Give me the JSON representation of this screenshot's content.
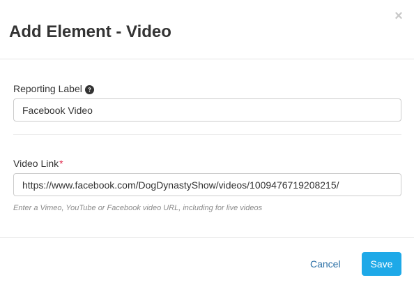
{
  "modal": {
    "title": "Add Element - Video",
    "close_glyph": "×"
  },
  "fields": {
    "reporting_label": {
      "label": "Reporting Label",
      "help_icon": "question-circle-icon",
      "value": "Facebook Video"
    },
    "video_link": {
      "label": "Video Link",
      "required_marker": "*",
      "value": "https://www.facebook.com/DogDynastyShow/videos/1009476719208215/",
      "help_text": "Enter a Vimeo, YouTube or Facebook video URL, including for live videos"
    }
  },
  "footer": {
    "cancel_label": "Cancel",
    "save_label": "Save"
  },
  "colors": {
    "primary": "#1ea9e8",
    "link": "#2a6fa5",
    "required": "#e0284a"
  }
}
